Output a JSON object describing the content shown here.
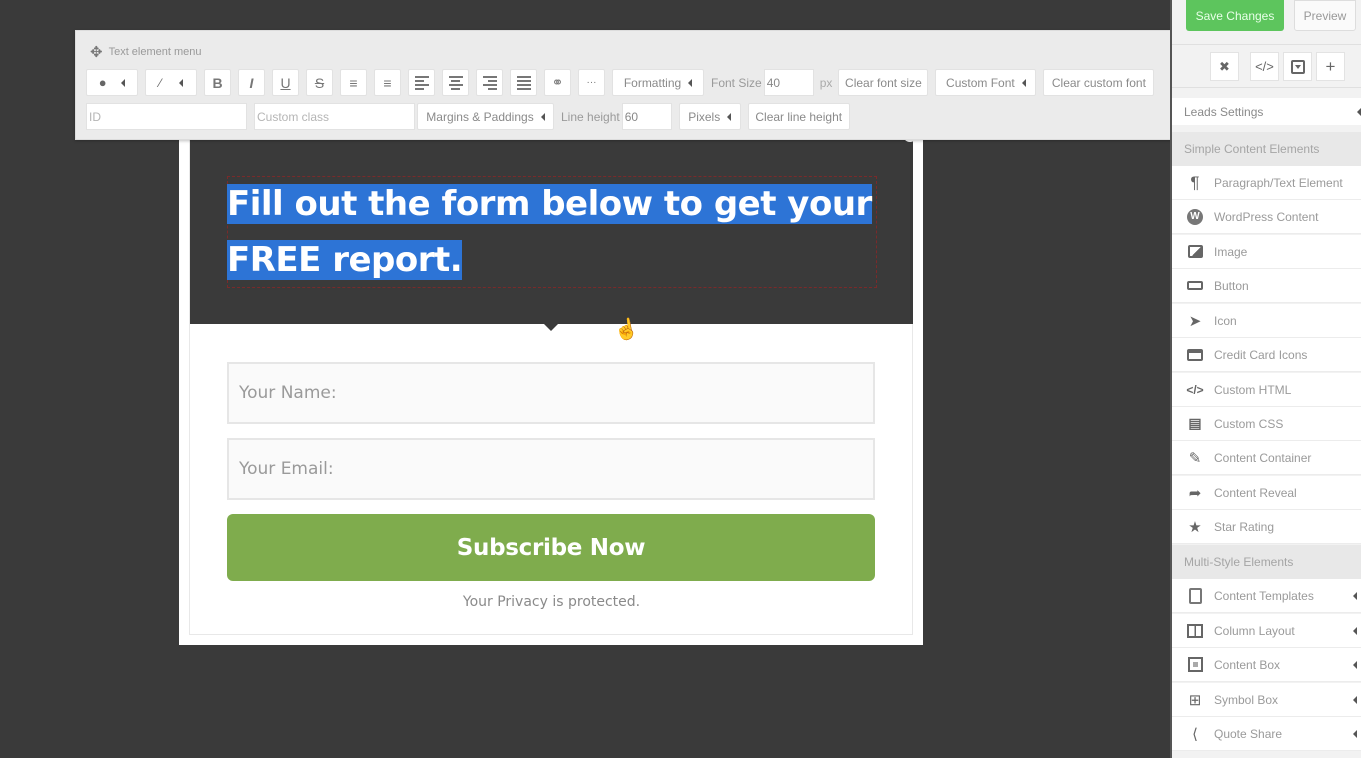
{
  "toolbar": {
    "title": "Text element menu",
    "buttons": {
      "bold": "B",
      "italic": "I",
      "underline": "U",
      "strike": "S",
      "more": "···",
      "formatting": "Formatting",
      "clear_font_size": "Clear font size",
      "custom_font": "Custom Font",
      "clear_custom_font": "Clear custom font",
      "margins_paddings": "Margins & Paddings",
      "pixels": "Pixels",
      "clear_line_height": "Clear line height"
    },
    "font_size_label": "Font Size",
    "font_size_value": "40",
    "font_size_unit": "px",
    "id_placeholder": "ID",
    "class_placeholder": "Custom class",
    "line_height_label": "Line height",
    "line_height_value": "60"
  },
  "form": {
    "headline_line1": "Fill out the form below to get your",
    "headline_line2": "FREE report.",
    "name_placeholder": "Your Name:",
    "email_placeholder": "Your Email:",
    "button_label": "Subscribe Now",
    "privacy_text": "Your Privacy is protected.",
    "button_color": "#7fac4d",
    "selection_color": "#2d74d6"
  },
  "sidebar": {
    "save_label": "Save Changes",
    "preview_label": "Preview",
    "settings_label": "Leads Settings",
    "sections": [
      {
        "title": "Simple Content Elements",
        "items": [
          {
            "label": "Paragraph/Text Element",
            "icon": "paragraph-icon"
          },
          {
            "label": "WordPress Content",
            "icon": "wordpress-icon"
          },
          {
            "label": "Image",
            "icon": "image-icon"
          },
          {
            "label": "Button",
            "icon": "button-icon"
          },
          {
            "label": "Icon",
            "icon": "rocket-icon"
          },
          {
            "label": "Credit Card Icons",
            "icon": "credit-card-icon"
          },
          {
            "label": "Custom HTML",
            "icon": "code-icon"
          },
          {
            "label": "Custom CSS",
            "icon": "css3-icon"
          },
          {
            "label": "Content Container",
            "icon": "edit-icon"
          },
          {
            "label": "Content Reveal",
            "icon": "share-arrow-icon"
          },
          {
            "label": "Star Rating",
            "icon": "star-icon"
          }
        ]
      },
      {
        "title": "Multi-Style Elements",
        "items": [
          {
            "label": "Content Templates",
            "icon": "file-icon"
          },
          {
            "label": "Column Layout",
            "icon": "columns-icon"
          },
          {
            "label": "Content Box",
            "icon": "content-box-icon"
          },
          {
            "label": "Symbol Box",
            "icon": "symbol-box-icon"
          },
          {
            "label": "Quote Share",
            "icon": "share-icon"
          }
        ]
      }
    ]
  }
}
